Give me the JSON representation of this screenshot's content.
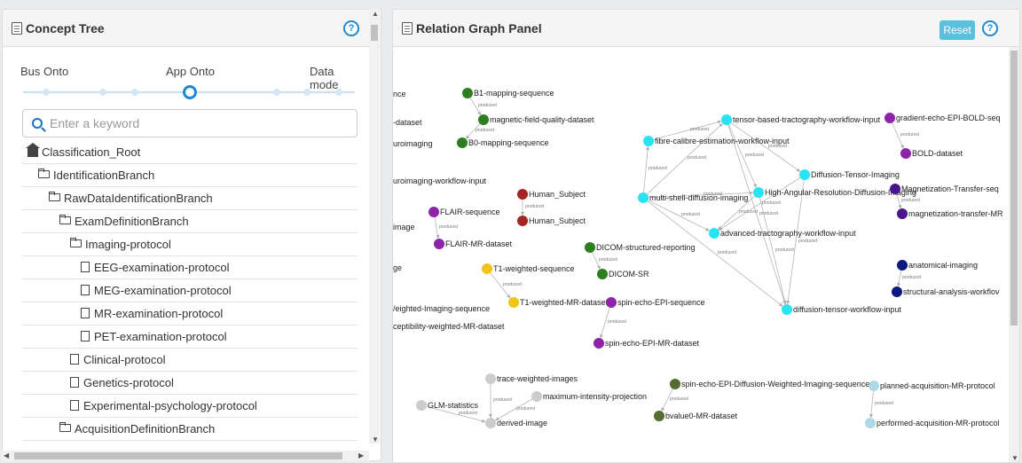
{
  "concept_tree": {
    "title": "Concept Tree",
    "help": "?",
    "tabs": [
      "Bus Onto",
      "App Onto",
      "Data mode"
    ],
    "search_placeholder": "Enter a keyword",
    "items": [
      {
        "label": "Classification_Root",
        "type": "root",
        "level": 0
      },
      {
        "label": "IdentificationBranch",
        "type": "folder",
        "level": 1
      },
      {
        "label": "RawDataIdentificationBranch",
        "type": "folder",
        "level": 2
      },
      {
        "label": "ExamDefinitionBranch",
        "type": "folder",
        "level": 3
      },
      {
        "label": "Imaging-protocol",
        "type": "folder",
        "level": 4
      },
      {
        "label": "EEG-examination-protocol",
        "type": "file",
        "level": 5
      },
      {
        "label": "MEG-examination-protocol",
        "type": "file",
        "level": 5
      },
      {
        "label": "MR-examination-protocol",
        "type": "file",
        "level": 5
      },
      {
        "label": "PET-examination-protocol",
        "type": "file",
        "level": 5
      },
      {
        "label": "Clinical-protocol",
        "type": "file",
        "level": 4
      },
      {
        "label": "Genetics-protocol",
        "type": "file",
        "level": 4
      },
      {
        "label": "Experimental-psychology-protocol",
        "type": "file",
        "level": 4
      },
      {
        "label": "AcquisitionDefinitionBranch",
        "type": "folder",
        "level": 3
      }
    ]
  },
  "relation_graph": {
    "title": "Relation Graph Panel",
    "reset_label": "Reset",
    "help": "?",
    "edge_label": "produced",
    "colors": {
      "darkgreen": "#2e7d1f",
      "cyan": "#29e3f2",
      "purple": "#8e24aa",
      "darkred": "#a52424",
      "yellow": "#f0c419",
      "navy": "#0a1a80",
      "darkpurple": "#4a148c",
      "gray": "#cccccc",
      "olive": "#556b2f",
      "lightblue": "#add8e6"
    },
    "clipped_labels": [
      "nce",
      "-dataset",
      "uroimaging",
      "uroimaging-workflow-input",
      "image",
      "ge",
      "/eighted-Imaging-sequence",
      "ceptibility-weighted-MR-dataset"
    ],
    "nodes": [
      {
        "id": "b1",
        "label": "B1-mapping-sequence",
        "color": "darkgreen"
      },
      {
        "id": "mfq",
        "label": "magnetic-field-quality-dataset",
        "color": "darkgreen"
      },
      {
        "id": "b0",
        "label": "B0-mapping-sequence",
        "color": "darkgreen"
      },
      {
        "id": "flair",
        "label": "FLAIR-sequence",
        "color": "purple"
      },
      {
        "id": "flairds",
        "label": "FLAIR-MR-dataset",
        "color": "purple"
      },
      {
        "id": "hs1",
        "label": "Human_Subject",
        "color": "darkred"
      },
      {
        "id": "hs2",
        "label": "Human_Subject",
        "color": "darkred"
      },
      {
        "id": "dicomsr",
        "label": "DICOM-structured-reporting",
        "color": "darkgreen"
      },
      {
        "id": "dicom",
        "label": "DICOM-SR",
        "color": "darkgreen"
      },
      {
        "id": "t1",
        "label": "T1-weighted-sequence",
        "color": "yellow"
      },
      {
        "id": "t1ds",
        "label": "T1-weighted-MR-dataset",
        "color": "yellow"
      },
      {
        "id": "seepi",
        "label": "spin-echo-EPI-sequence",
        "color": "purple"
      },
      {
        "id": "seepids",
        "label": "spin-echo-EPI-MR-dataset",
        "color": "purple"
      },
      {
        "id": "fibre",
        "label": "fibre-calibre-estimation-workflow-input",
        "color": "cyan"
      },
      {
        "id": "tbt",
        "label": "tensor-based-tractography-workflow-input",
        "color": "cyan"
      },
      {
        "id": "msd",
        "label": "multi-shell-diffusion-imaging",
        "color": "cyan"
      },
      {
        "id": "dti",
        "label": "Diffusion-Tensor-Imaging",
        "color": "cyan"
      },
      {
        "id": "hard",
        "label": "High-Angular-Resolution-Diffusion-Imaging",
        "color": "cyan"
      },
      {
        "id": "atw",
        "label": "advanced-tractography-workflow-input",
        "color": "cyan"
      },
      {
        "id": "dtw",
        "label": "diffusion-tensor-workflow-input",
        "color": "cyan"
      },
      {
        "id": "gre",
        "label": "gradient-echo-EPI-BOLD-seq",
        "color": "purple"
      },
      {
        "id": "bold",
        "label": "BOLD-dataset",
        "color": "purple"
      },
      {
        "id": "mts",
        "label": "Magnetization-Transfer-seq",
        "color": "darkpurple"
      },
      {
        "id": "mtmr",
        "label": "magnetization-transfer-MR",
        "color": "darkpurple"
      },
      {
        "id": "anat",
        "label": "anatomical-imaging",
        "color": "navy"
      },
      {
        "id": "sawf",
        "label": "structural-analysis-workflov",
        "color": "navy"
      },
      {
        "id": "twi",
        "label": "trace-weighted-images",
        "color": "gray"
      },
      {
        "id": "glm",
        "label": "GLM-statistics",
        "color": "gray"
      },
      {
        "id": "mip",
        "label": "maximum-intensity-projection",
        "color": "gray"
      },
      {
        "id": "derived",
        "label": "derived-image",
        "color": "gray"
      },
      {
        "id": "sedwi",
        "label": "spin-echo-EPI-Diffusion-Weighted-Imaging-sequence",
        "color": "olive"
      },
      {
        "id": "bval",
        "label": "bvalue0-MR-dataset",
        "color": "olive"
      },
      {
        "id": "pamp",
        "label": "planned-acquisition-MR-protocol",
        "color": "lightblue"
      },
      {
        "id": "perf",
        "label": "performed-acquisition-MR-protocol",
        "color": "lightblue"
      }
    ],
    "edges": [
      [
        "b1",
        "mfq"
      ],
      [
        "mfq",
        "b0"
      ],
      [
        "flair",
        "flairds"
      ],
      [
        "hs1",
        "hs2"
      ],
      [
        "dicomsr",
        "dicom"
      ],
      [
        "t1",
        "t1ds"
      ],
      [
        "seepi",
        "seepids"
      ],
      [
        "msd",
        "fibre"
      ],
      [
        "fibre",
        "tbt"
      ],
      [
        "msd",
        "tbt"
      ],
      [
        "tbt",
        "dti"
      ],
      [
        "tbt",
        "hard"
      ],
      [
        "msd",
        "hard"
      ],
      [
        "msd",
        "atw"
      ],
      [
        "dti",
        "atw"
      ],
      [
        "hard",
        "atw"
      ],
      [
        "msd",
        "dtw"
      ],
      [
        "hard",
        "dtw"
      ],
      [
        "dti",
        "dtw"
      ],
      [
        "tbt",
        "dtw"
      ],
      [
        "gre",
        "bold"
      ],
      [
        "mts",
        "mtmr"
      ],
      [
        "anat",
        "sawf"
      ],
      [
        "twi",
        "derived"
      ],
      [
        "glm",
        "derived"
      ],
      [
        "mip",
        "derived"
      ],
      [
        "sedwi",
        "bval"
      ],
      [
        "pamp",
        "perf"
      ]
    ]
  }
}
